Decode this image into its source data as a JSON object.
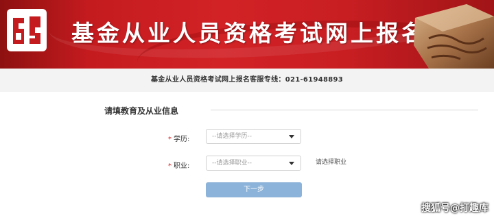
{
  "banner": {
    "title": "基金从业人员资格考试网上报名",
    "background_color": "#cc1f23"
  },
  "hotline": "基金从业人员资格考试网上报名客服专线：021-61948893",
  "form": {
    "section_title": "请填教育及从业信息",
    "education": {
      "required_mark": "*",
      "label": "学历:",
      "value": "--请选择学历--"
    },
    "occupation": {
      "required_mark": "*",
      "label": "职业:",
      "value": "--请选择职业--",
      "hint": "请选择职业"
    },
    "next_button": "下一步",
    "button_color": "#8cb3d9"
  },
  "watermark": "搜狐号@打趣库"
}
